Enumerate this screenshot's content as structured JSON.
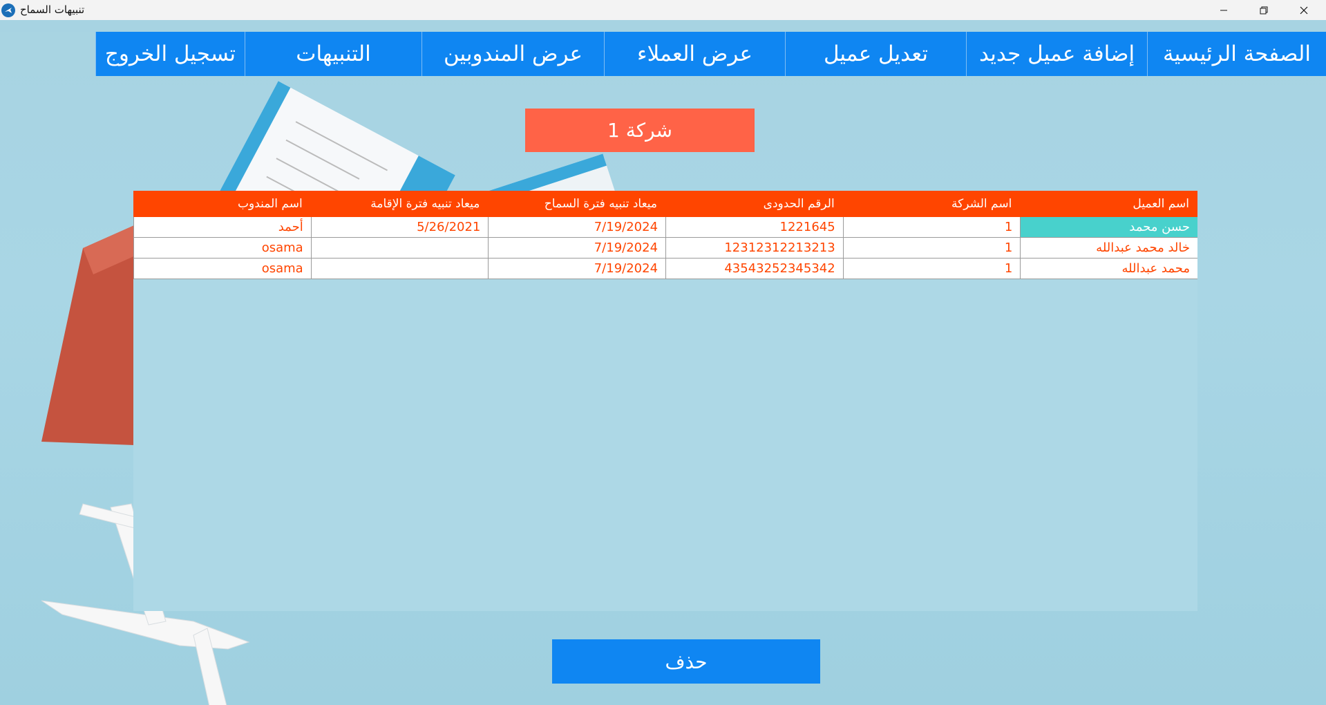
{
  "window": {
    "title": "تنبيهات السماح",
    "icon": "app-plane-icon"
  },
  "colors": {
    "nav": "#0f86f2",
    "company_label": "#ff6347",
    "grid_header": "#ff4500",
    "cell_text": "#ff4500",
    "selected_cell": "#48d1cc",
    "grid_background": "#add8e6"
  },
  "nav": {
    "items": [
      {
        "label": "الصفحة الرئيسية"
      },
      {
        "label": "إضافة عميل جديد"
      },
      {
        "label": "تعديل عميل"
      },
      {
        "label": "عرض العملاء"
      },
      {
        "label": "عرض المندوبين"
      },
      {
        "label": "التنبيهات"
      },
      {
        "label": "تسجيل الخروج"
      }
    ]
  },
  "company": {
    "label": "شركة 1"
  },
  "grid": {
    "columns": [
      "اسم العميل",
      "اسم الشركة",
      "الرقم الحدودى",
      "ميعاد تنبيه فترة السماح",
      "ميعاد تنبيه فترة الإقامة",
      "اسم المندوب"
    ],
    "rows": [
      [
        "حسن محمد",
        "1",
        "1221645",
        "7/19/2024",
        "5/26/2021",
        "أحمد"
      ],
      [
        "خالد محمد عبدالله",
        "1",
        "12312312213213",
        "7/19/2024",
        "",
        "osama"
      ],
      [
        "محمد عبدالله",
        "1",
        "43543252345342",
        "7/19/2024",
        "",
        "osama"
      ]
    ]
  },
  "actions": {
    "delete_label": "حذف"
  }
}
